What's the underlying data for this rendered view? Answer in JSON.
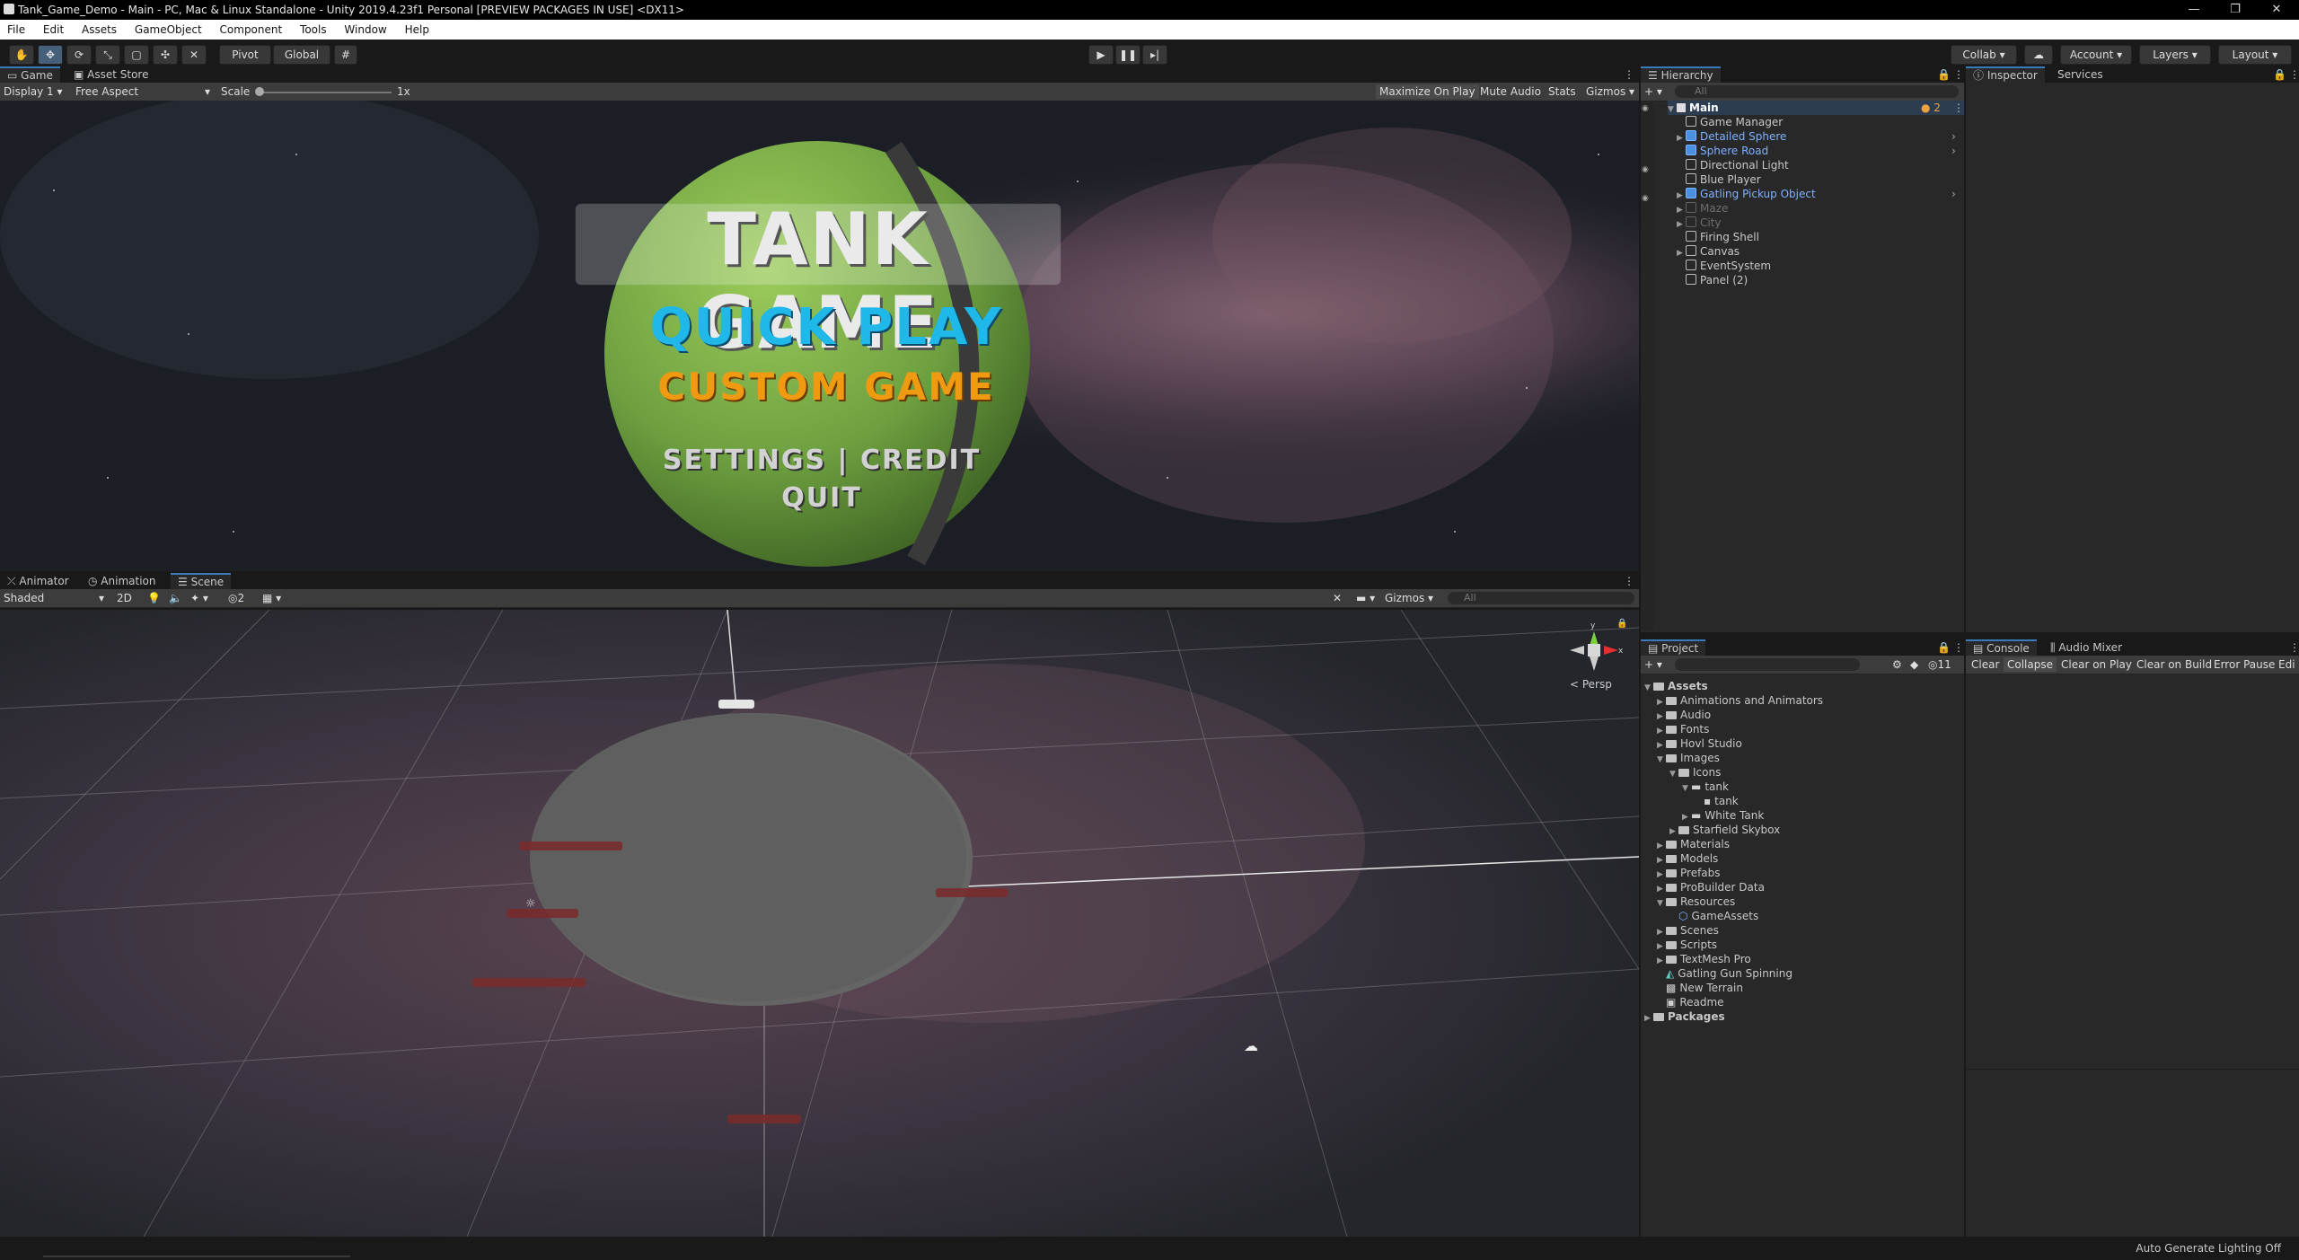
{
  "window": {
    "title": "Tank_Game_Demo - Main - PC, Mac & Linux Standalone - Unity 2019.4.23f1 Personal [PREVIEW PACKAGES IN USE] <DX11>",
    "controls": [
      "—",
      "❐",
      "✕"
    ]
  },
  "menu": [
    "File",
    "Edit",
    "Assets",
    "GameObject",
    "Component",
    "Tools",
    "Window",
    "Help"
  ],
  "toolbar": {
    "pivot": "Pivot",
    "global": "Global",
    "collab": "Collab",
    "account": "Account",
    "layers": "Layers",
    "layout": "Layout"
  },
  "game_tabs": {
    "game": "Game",
    "asset_store": "Asset Store"
  },
  "game_bar": {
    "display": "Display 1",
    "aspect": "Free Aspect",
    "scale_label": "Scale",
    "scale_value": "1x",
    "maximize": "Maximize On Play",
    "mute": "Mute Audio",
    "stats": "Stats",
    "gizmos": "Gizmos"
  },
  "game_menu": {
    "title": "TANK GAME",
    "quick_play": "QUICK PLAY",
    "custom_game": "CUSTOM GAME",
    "settings_credit": "SETTINGS | CREDIT",
    "quit": "QUIT"
  },
  "scene_tabs": {
    "animator": "Animator",
    "animation": "Animation",
    "scene": "Scene"
  },
  "scene_bar": {
    "shading": "Shaded",
    "mode_2d": "2D",
    "hidden_count": "2",
    "gizmos": "Gizmos",
    "search_placeholder": "All",
    "persp": "< Persp"
  },
  "hierarchy": {
    "tab": "Hierarchy",
    "search_placeholder": "All",
    "scene": "Main",
    "scene_badge": "2",
    "items": [
      {
        "label": "Game Manager",
        "blue": false,
        "dim": false,
        "arrow": false
      },
      {
        "label": "Detailed Sphere",
        "blue": true,
        "dim": false,
        "arrow": true
      },
      {
        "label": "Sphere Road",
        "blue": true,
        "dim": false,
        "arrow": false
      },
      {
        "label": "Directional Light",
        "blue": false,
        "dim": false,
        "arrow": false
      },
      {
        "label": "Blue Player",
        "blue": false,
        "dim": false,
        "arrow": false
      },
      {
        "label": "Gatling Pickup Object",
        "blue": true,
        "dim": false,
        "arrow": true
      },
      {
        "label": "Maze",
        "blue": false,
        "dim": true,
        "arrow": true
      },
      {
        "label": "City",
        "blue": false,
        "dim": true,
        "arrow": true
      },
      {
        "label": "Firing Shell",
        "blue": false,
        "dim": false,
        "arrow": false
      },
      {
        "label": "Canvas",
        "blue": false,
        "dim": false,
        "arrow": true
      },
      {
        "label": "EventSystem",
        "blue": false,
        "dim": false,
        "arrow": false
      },
      {
        "label": "Panel (2)",
        "blue": false,
        "dim": false,
        "arrow": false
      }
    ]
  },
  "inspector": {
    "inspector": "Inspector",
    "services": "Services"
  },
  "project": {
    "tab": "Project",
    "hidden_count": "11",
    "tree": [
      {
        "label": "Assets",
        "type": "folder",
        "bold": true
      },
      {
        "label": "Animations and Animators",
        "type": "folder"
      },
      {
        "label": "Audio",
        "type": "folder"
      },
      {
        "label": "Fonts",
        "type": "folder"
      },
      {
        "label": "Hovl Studio",
        "type": "folder"
      },
      {
        "label": "Images",
        "type": "folder"
      },
      {
        "label": "Icons",
        "type": "folder"
      },
      {
        "label": "tank",
        "type": "asset"
      },
      {
        "label": "tank",
        "type": "sprite"
      },
      {
        "label": "White Tank",
        "type": "asset"
      },
      {
        "label": "Starfield Skybox",
        "type": "folder"
      },
      {
        "label": "Materials",
        "type": "folder"
      },
      {
        "label": "Models",
        "type": "folder"
      },
      {
        "label": "Prefabs",
        "type": "folder"
      },
      {
        "label": "ProBuilder Data",
        "type": "folder"
      },
      {
        "label": "Resources",
        "type": "folder"
      },
      {
        "label": "GameAssets",
        "type": "prefab"
      },
      {
        "label": "Scenes",
        "type": "folder"
      },
      {
        "label": "Scripts",
        "type": "folder"
      },
      {
        "label": "TextMesh Pro",
        "type": "folder"
      },
      {
        "label": "Gatling Gun Spinning",
        "type": "anim"
      },
      {
        "label": "New Terrain",
        "type": "terrain"
      },
      {
        "label": "Readme",
        "type": "readme"
      },
      {
        "label": "Packages",
        "type": "folder",
        "bold": true
      }
    ]
  },
  "console": {
    "tab": "Console",
    "mixer": "Audio Mixer",
    "clear": "Clear",
    "collapse": "Collapse",
    "clear_on_play": "Clear on Play",
    "clear_on_build": "Clear on Build",
    "error_pause": "Error Pause",
    "editor": "Edi"
  },
  "status": {
    "lighting": "Auto Generate Lighting Off"
  },
  "colors": {
    "accent": "#3a79bb",
    "prefab": "#7fb0ff",
    "sphere": "#7fb04a",
    "quick_play": "#1fb8e8",
    "custom_game": "#f09a12"
  }
}
